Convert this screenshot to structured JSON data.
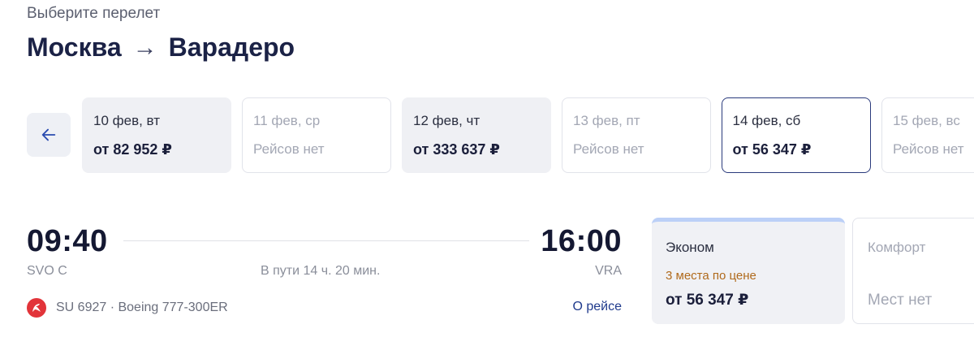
{
  "header": {
    "subtitle": "Выберите перелет",
    "origin": "Москва",
    "route_arrow": "→",
    "destination": "Варадеро"
  },
  "date_strip": {
    "back_icon": "arrow-left-icon",
    "dates": [
      {
        "date": "10 фев, вт",
        "price": "от 82 952 ₽",
        "state": "available"
      },
      {
        "date": "11 фев, ср",
        "price": "Рейсов нет",
        "state": "empty"
      },
      {
        "date": "12 фев, чт",
        "price": "от 333 637 ₽",
        "state": "available"
      },
      {
        "date": "13 фев, пт",
        "price": "Рейсов нет",
        "state": "empty"
      },
      {
        "date": "14 фев, сб",
        "price": "от 56 347 ₽",
        "state": "selected"
      },
      {
        "date": "15 фев, вс",
        "price": "Рейсов нет",
        "state": "empty"
      }
    ]
  },
  "flight": {
    "departure_time": "09:40",
    "arrival_time": "16:00",
    "departure_code": "SVO C",
    "arrival_code": "VRA",
    "duration": "В пути 14 ч. 20 мин.",
    "airline_icon": "aeroflot-logo-icon",
    "flight_info": "SU 6927 · Boeing 777-300ER",
    "about_link": "О рейсе"
  },
  "fares": [
    {
      "name": "Эконом",
      "seats": "3 места по цене",
      "price": "от 56 347 ₽",
      "state": "available"
    },
    {
      "name": "Комфорт",
      "seats": "",
      "price": "Мест нет",
      "state": "unavailable"
    }
  ],
  "colors": {
    "accent": "#2a3a7c",
    "card_bg": "#eff0f4",
    "warning": "#b06a1c",
    "econ_stripe": "#bcd0f7",
    "airline_red": "#e2343a"
  }
}
